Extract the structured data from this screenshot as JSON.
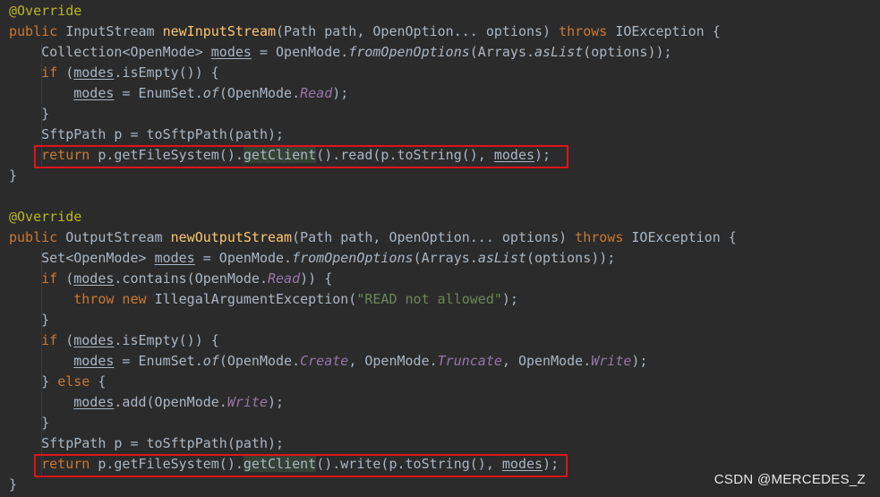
{
  "lines": [
    [
      {
        "t": "@Override",
        "c": "ann"
      }
    ],
    [
      {
        "t": "public ",
        "c": "kw"
      },
      {
        "t": "InputStream "
      },
      {
        "t": "newInputStream",
        "c": "fn"
      },
      {
        "t": "(Path path, OpenOption... options) "
      },
      {
        "t": "throws ",
        "c": "kw"
      },
      {
        "t": "IOException {"
      }
    ],
    [
      {
        "t": "    Collection<OpenMode> "
      },
      {
        "t": "modes",
        "c": "ul"
      },
      {
        "t": " = OpenMode."
      },
      {
        "t": "fromOpenOptions",
        "c": "st"
      },
      {
        "t": "(Arrays."
      },
      {
        "t": "asList",
        "c": "st"
      },
      {
        "t": "(options));"
      }
    ],
    [
      {
        "t": "    "
      },
      {
        "t": "if ",
        "c": "kw"
      },
      {
        "t": "("
      },
      {
        "t": "modes",
        "c": "ul"
      },
      {
        "t": ".isEmpty()) {"
      }
    ],
    [
      {
        "t": "        "
      },
      {
        "t": "modes",
        "c": "ul"
      },
      {
        "t": " = EnumSet."
      },
      {
        "t": "of",
        "c": "st"
      },
      {
        "t": "(OpenMode."
      },
      {
        "t": "Read",
        "c": "it"
      },
      {
        "t": ");"
      }
    ],
    [
      {
        "t": "    }"
      }
    ],
    [
      {
        "t": "    SftpPath p = toSftpPath(path);"
      }
    ],
    [
      {
        "t": "    "
      },
      {
        "t": "return ",
        "c": "kw"
      },
      {
        "t": "p.getFileSystem()."
      },
      {
        "t": "getClient",
        "c": "hl"
      },
      {
        "t": "().read(p.toString(), "
      },
      {
        "t": "modes",
        "c": "ul"
      },
      {
        "t": ");"
      }
    ],
    [
      {
        "t": "}"
      }
    ],
    [],
    [
      {
        "t": "@Override",
        "c": "ann"
      }
    ],
    [
      {
        "t": "public ",
        "c": "kw"
      },
      {
        "t": "OutputStream "
      },
      {
        "t": "newOutputStream",
        "c": "fn"
      },
      {
        "t": "(Path path, OpenOption... options) "
      },
      {
        "t": "throws ",
        "c": "kw"
      },
      {
        "t": "IOException {"
      }
    ],
    [
      {
        "t": "    Set<OpenMode> "
      },
      {
        "t": "modes",
        "c": "ul"
      },
      {
        "t": " = OpenMode."
      },
      {
        "t": "fromOpenOptions",
        "c": "st"
      },
      {
        "t": "(Arrays."
      },
      {
        "t": "asList",
        "c": "st"
      },
      {
        "t": "(options));"
      }
    ],
    [
      {
        "t": "    "
      },
      {
        "t": "if ",
        "c": "kw"
      },
      {
        "t": "("
      },
      {
        "t": "modes",
        "c": "ul"
      },
      {
        "t": ".contains(OpenMode."
      },
      {
        "t": "Read",
        "c": "it"
      },
      {
        "t": ")) {"
      }
    ],
    [
      {
        "t": "        "
      },
      {
        "t": "throw new ",
        "c": "kw"
      },
      {
        "t": "IllegalArgumentException("
      },
      {
        "t": "\"READ not allowed\"",
        "c": "str"
      },
      {
        "t": ");"
      }
    ],
    [
      {
        "t": "    }"
      }
    ],
    [
      {
        "t": "    "
      },
      {
        "t": "if ",
        "c": "kw"
      },
      {
        "t": "("
      },
      {
        "t": "modes",
        "c": "ul"
      },
      {
        "t": ".isEmpty()) {"
      }
    ],
    [
      {
        "t": "        "
      },
      {
        "t": "modes",
        "c": "ul"
      },
      {
        "t": " = EnumSet."
      },
      {
        "t": "of",
        "c": "st"
      },
      {
        "t": "(OpenMode."
      },
      {
        "t": "Create",
        "c": "it"
      },
      {
        "t": ", OpenMode."
      },
      {
        "t": "Truncate",
        "c": "it"
      },
      {
        "t": ", OpenMode."
      },
      {
        "t": "Write",
        "c": "it"
      },
      {
        "t": ");"
      }
    ],
    [
      {
        "t": "    } "
      },
      {
        "t": "else ",
        "c": "kw"
      },
      {
        "t": "{"
      }
    ],
    [
      {
        "t": "        "
      },
      {
        "t": "modes",
        "c": "ul"
      },
      {
        "t": ".add(OpenMode."
      },
      {
        "t": "Write",
        "c": "it"
      },
      {
        "t": ");"
      }
    ],
    [
      {
        "t": "    }"
      }
    ],
    [
      {
        "t": "    SftpPath p = toSftpPath(path);"
      }
    ],
    [
      {
        "t": "    "
      },
      {
        "t": "return ",
        "c": "kw"
      },
      {
        "t": "p.getFileSystem()."
      },
      {
        "t": "getClient",
        "c": "hl"
      },
      {
        "t": "().write(p.toString(), "
      },
      {
        "t": "modes",
        "c": "ul"
      },
      {
        "t": ");"
      }
    ],
    [
      {
        "t": "}"
      }
    ]
  ],
  "highlighted_lines": [
    7,
    22
  ],
  "watermark": "CSDN @MERCEDES_Z",
  "colors": {
    "background": "#2b2b2b",
    "text": "#a9b7c6",
    "keyword": "#cc7832",
    "annotation": "#bbb529",
    "method_declaration": "#ffc66d",
    "string": "#6a8759",
    "enum_constant": "#9876aa",
    "highlight_box": "#e0141b"
  }
}
